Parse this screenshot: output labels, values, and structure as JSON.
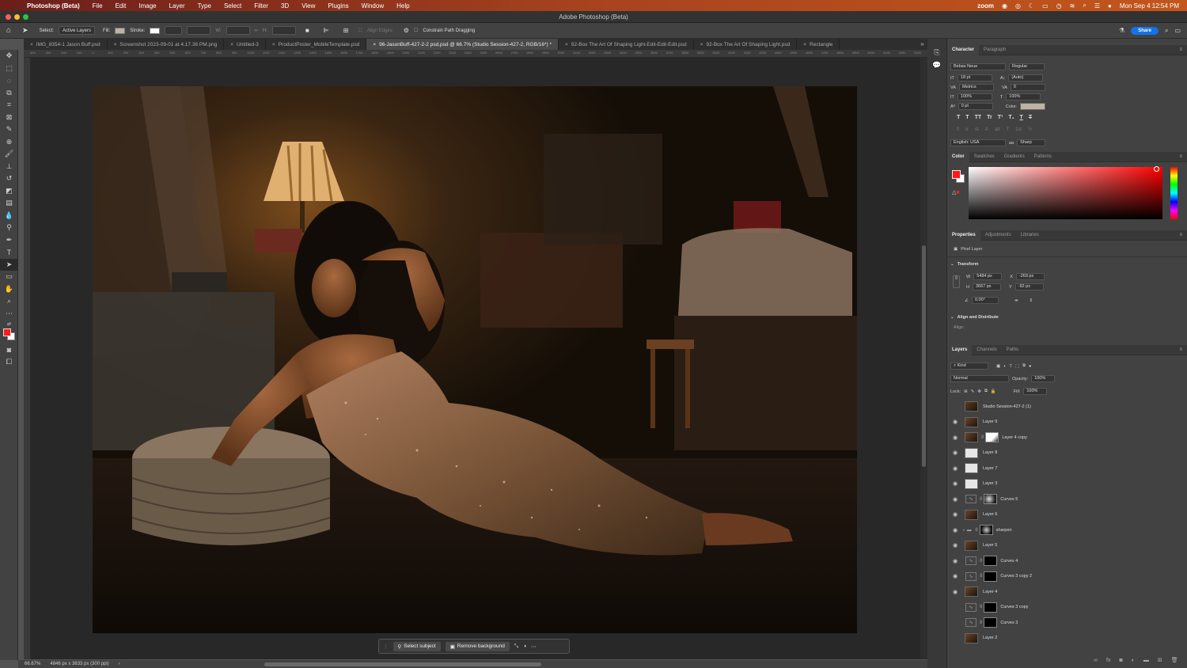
{
  "menubar": {
    "app_name": "Photoshop (Beta)",
    "items": [
      "File",
      "Edit",
      "Image",
      "Layer",
      "Type",
      "Select",
      "Filter",
      "3D",
      "View",
      "Plugins",
      "Window",
      "Help"
    ],
    "zoom_label": "zoom",
    "datetime": "Mon Sep 4  12:54 PM"
  },
  "window": {
    "title": "Adobe Photoshop (Beta)"
  },
  "options": {
    "select_label": "Select:",
    "select_value": "Active Layers",
    "fill_label": "Fill:",
    "stroke_label": "Stroke:",
    "w_label": "W:",
    "h_label": "H:",
    "align_edges": "Align Edges",
    "constrain": "Constrain Path Dragging",
    "share": "Share"
  },
  "tabs": [
    {
      "label": "IMG_8354-1 Jason Buff.psd"
    },
    {
      "label": "Screenshot 2023-09-01 at 4.17.36 PM.png"
    },
    {
      "label": "Untitled-3"
    },
    {
      "label": "ProductPoster_MobileTemplate.psd"
    },
    {
      "label": "96-JasonBuff-427-2-2 psd.psd @ 66.7% (Studio Session-427-2, RGB/16*) *"
    },
    {
      "label": "92-Box The Art Of Shaping Light-Edit-Edit-Edit.psd"
    },
    {
      "label": "92-Box The Art Of Shaping Light.psd"
    },
    {
      "label": "Rectangle"
    }
  ],
  "ruler_ticks": [
    "400",
    "300",
    "200",
    "100",
    "0",
    "100",
    "200",
    "300",
    "400",
    "500",
    "600",
    "700",
    "800",
    "900",
    "1000",
    "1100",
    "1200",
    "1300",
    "1400",
    "1500",
    "1600",
    "1700",
    "1800",
    "1900",
    "2000",
    "2100",
    "2200",
    "2300",
    "2400",
    "2500",
    "2600",
    "2700",
    "2800",
    "2900",
    "3000",
    "3100",
    "3200",
    "3300",
    "3400",
    "3500",
    "3600",
    "3700",
    "3800",
    "3900",
    "4000",
    "4100",
    "4200",
    "4300",
    "4400",
    "4500",
    "4600",
    "4700",
    "4800",
    "4900",
    "5000",
    "5100",
    "5200",
    "5300"
  ],
  "status": {
    "zoom": "66.67%",
    "doc_info": "4846 px x 3633 px (300 ppi)"
  },
  "context_bar": {
    "select_subject": "Select subject",
    "remove_background": "Remove background"
  },
  "character": {
    "tab": "Character",
    "tab2": "Paragraph",
    "font": "Bebas Neue",
    "style": "Regular",
    "size": "18 pt",
    "leading": "(Auto)",
    "kerning": "Metrics",
    "tracking": "0",
    "vscale": "100%",
    "hscale": "100%",
    "baseline": "0 pt",
    "color_label": "Color:",
    "language": "English: USA",
    "aa_label": "aa",
    "aa": "Sharp",
    "style_buttons": [
      "T",
      "T",
      "TT",
      "Tr",
      "T¹",
      "T₁",
      "T",
      "T"
    ],
    "ot_buttons": [
      "fi",
      "ơ",
      "st",
      "A",
      "ad",
      "T",
      "1st",
      "½"
    ]
  },
  "color_panel": {
    "tabs": [
      "Color",
      "Swatches",
      "Gradients",
      "Patterns"
    ],
    "fg": "#ff1a1a",
    "bg": "#ffffff",
    "hue": "#ff0000"
  },
  "properties": {
    "tabs": [
      "Properties",
      "Adjustments",
      "Libraries"
    ],
    "kind": "Pixel Layer",
    "transform": "Transform",
    "w_label": "W",
    "w": "5484 px",
    "x_label": "X",
    "x": "-269 px",
    "h_label": "H",
    "h": "3667 px",
    "y_label": "Y",
    "y": "-92 px",
    "angle": "0.00°",
    "align": "Align and Distribute",
    "align_label": "Align:"
  },
  "layers_panel": {
    "tabs": [
      "Layers",
      "Channels",
      "Paths"
    ],
    "filter": "Kind",
    "blend": "Normal",
    "opacity_label": "Opacity:",
    "opacity": "100%",
    "lock_label": "Lock:",
    "fill_label": "Fill:",
    "fill": "100%",
    "layers": [
      {
        "name": "Studio Session-427-2 (1)",
        "type": "smart",
        "visible": false
      },
      {
        "name": "Layer 9",
        "type": "pixel",
        "visible": true
      },
      {
        "name": "Layer 4 copy",
        "type": "masked",
        "visible": true
      },
      {
        "name": "Layer 8",
        "type": "light",
        "visible": true
      },
      {
        "name": "Layer 7",
        "type": "light",
        "visible": true
      },
      {
        "name": "Layer 3",
        "type": "light",
        "visible": true
      },
      {
        "name": "Curves 5",
        "type": "curves-soft",
        "visible": true
      },
      {
        "name": "Layer 6",
        "type": "pixel",
        "visible": true
      },
      {
        "name": "sharpen",
        "type": "group",
        "visible": true
      },
      {
        "name": "Layer 5",
        "type": "pixel",
        "visible": true
      },
      {
        "name": "Curves 4",
        "type": "curves-black",
        "visible": true
      },
      {
        "name": "Curves 3 copy 2",
        "type": "curves-black",
        "visible": true
      },
      {
        "name": "Layer 4",
        "type": "pixel",
        "visible": true
      },
      {
        "name": "Curves 3 copy",
        "type": "curves-black",
        "visible": false
      },
      {
        "name": "Curves 3",
        "type": "curves-black",
        "visible": false
      },
      {
        "name": "Layer 2",
        "type": "pixel",
        "visible": false
      }
    ]
  }
}
